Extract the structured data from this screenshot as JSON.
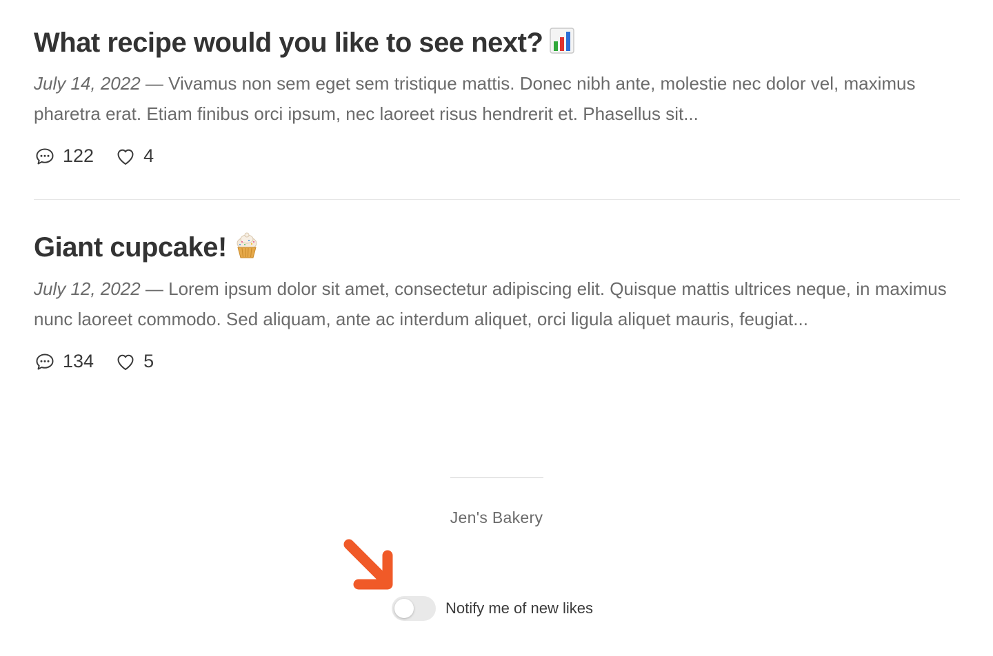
{
  "posts": [
    {
      "title": "What recipe would you like to see next?",
      "emoji_icon": "bar-chart-emoji",
      "date": "July 14, 2022",
      "separator": " — ",
      "excerpt": "Vivamus non sem eget sem tristique mattis. Donec nibh ante, molestie nec dolor vel, maximus pharetra erat. Etiam finibus orci ipsum, nec laoreet risus hendrerit et. Phasellus sit...",
      "comments": "122",
      "likes": "4"
    },
    {
      "title": "Giant cupcake!",
      "emoji_icon": "cupcake-emoji",
      "date": "July 12, 2022",
      "separator": " — ",
      "excerpt": "Lorem ipsum dolor sit amet, consectetur adipiscing elit. Quisque mattis ultrices neque, in maximus nunc laoreet commodo. Sed aliquam, ante ac interdum aliquet, orci ligula aliquet mauris, feugiat...",
      "comments": "134",
      "likes": "5"
    }
  ],
  "footer": {
    "site_name": "Jen's Bakery"
  },
  "notify": {
    "label": "Notify me of new likes",
    "enabled": false
  },
  "colors": {
    "arrow": "#f05a28",
    "title": "#333333",
    "excerpt": "#6b6b6b",
    "toggle_off": "#e9e9e9"
  }
}
